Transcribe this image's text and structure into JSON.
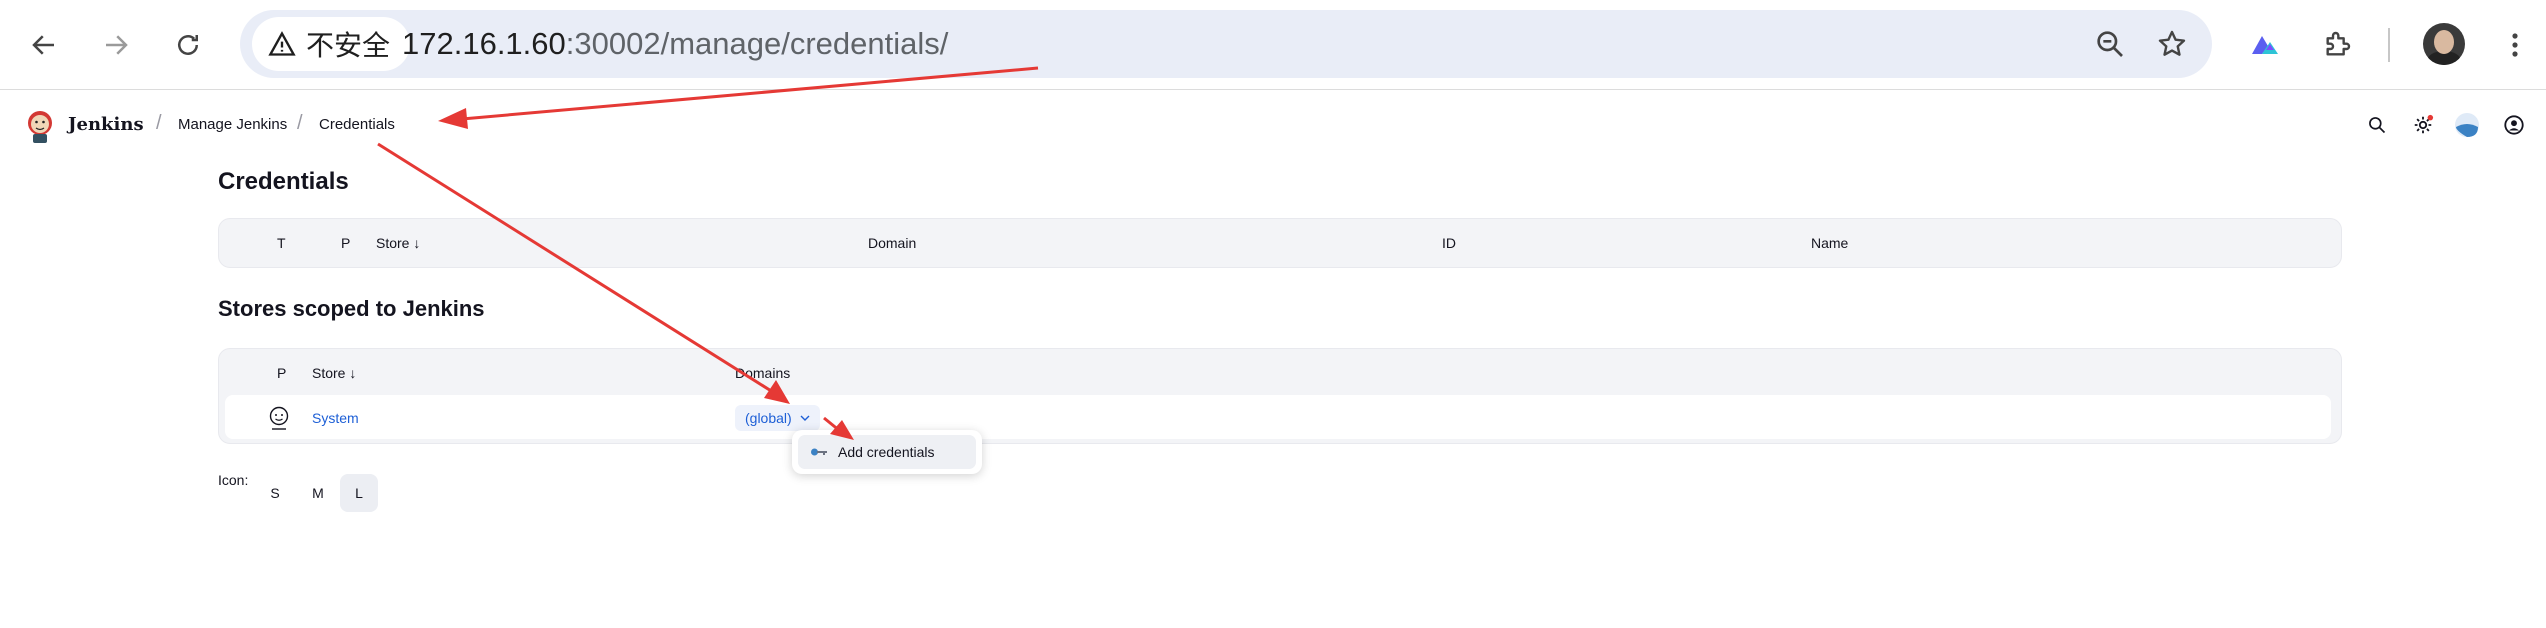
{
  "browser": {
    "security_label": "不安全",
    "url_host": "172.16.1.60",
    "url_rest": ":30002/manage/credentials/",
    "icons": [
      "back-arrow-icon",
      "forward-arrow-icon",
      "reload-icon",
      "warning-icon",
      "zoom-out-icon",
      "star-icon",
      "extension-icon",
      "puzzle-icon",
      "more-vert-icon"
    ]
  },
  "jenkins": {
    "title": "Jenkins",
    "breadcrumbs": [
      "Manage Jenkins",
      "Credentials"
    ]
  },
  "page": {
    "title": "Credentials",
    "credentials_table": {
      "headers": [
        "T",
        "P",
        "Store ↓",
        "Domain",
        "ID",
        "Name"
      ]
    },
    "stores_title": "Stores scoped to Jenkins",
    "stores_table": {
      "headers": [
        "P",
        "Store ↓",
        "Domains"
      ],
      "rows": [
        {
          "store": "System",
          "domain": "(global)"
        }
      ]
    },
    "dropdown": {
      "item": "Add credentials"
    },
    "icon_size": {
      "label": "Icon:",
      "options": [
        "S",
        "M",
        "L"
      ],
      "selected": "L"
    }
  },
  "colors": {
    "annotation_arrow": "#e53935",
    "link": "#1d5fd6",
    "omnibox": "#e9edf7"
  }
}
